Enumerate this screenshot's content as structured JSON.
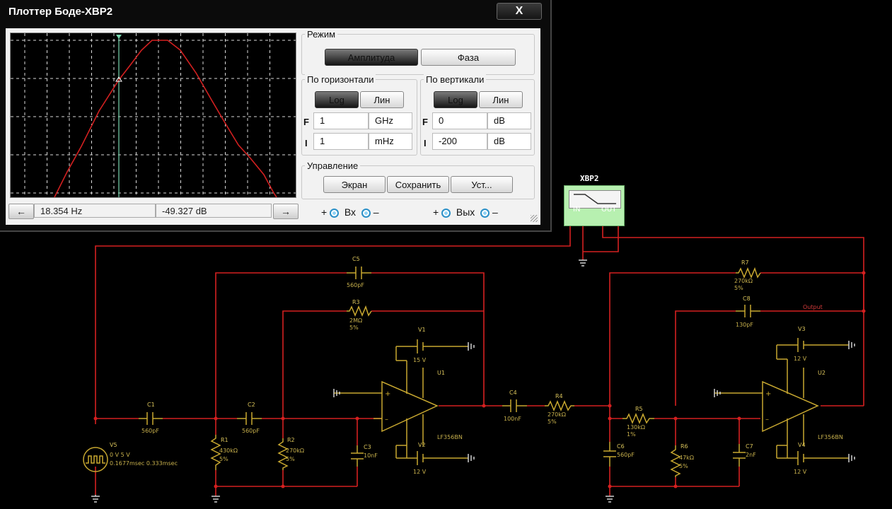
{
  "window": {
    "title": "Плоттер Боде-XBP2",
    "close_label": "X"
  },
  "plot": {
    "cursor_frequency": "18.354 Hz",
    "cursor_value": "-49.327 dB",
    "left_arrow": "←",
    "right_arrow": "→",
    "trace_color": "#d22020",
    "cursor_color": "#78d8b0"
  },
  "mode": {
    "title": "Режим",
    "amplitude_label": "Амплитуда",
    "phase_label": "Фаза",
    "active": "Амплитуда"
  },
  "horizontal": {
    "title": "По горизонтали",
    "log_label": "Log",
    "lin_label": "Лин",
    "active": "Log",
    "F_letter": "F",
    "I_letter": "I",
    "final_value": "1",
    "final_unit": "GHz",
    "initial_value": "1",
    "initial_unit": "mHz"
  },
  "vertical": {
    "title": "По вертикали",
    "log_label": "Log",
    "lin_label": "Лин",
    "active": "Log",
    "F_letter": "F",
    "I_letter": "I",
    "final_value": "0",
    "final_unit": "dB",
    "initial_value": "-200",
    "initial_unit": "dB"
  },
  "control": {
    "title": "Управление",
    "screen_label": "Экран",
    "save_label": "Сохранить",
    "settings_label": "Уст..."
  },
  "io": {
    "plus": "+",
    "minus": "–",
    "in_label": "Вх",
    "out_label": "Вых"
  },
  "instrument": {
    "name": "XBP2",
    "in_label": "IN",
    "out_label": "OUT"
  },
  "schematic": {
    "components": {
      "C5": {
        "label": "C5",
        "value": "560pF"
      },
      "R3": {
        "label": "R3",
        "value": "2MΩ",
        "tol": "5%"
      },
      "V1": {
        "label": "V1",
        "value": "15 V"
      },
      "U1": {
        "label": "U1",
        "part": "LF356BN"
      },
      "V2": {
        "label": "V2",
        "value": "12 V"
      },
      "C1": {
        "label": "C1",
        "value": "560pF"
      },
      "C2": {
        "label": "C2",
        "value": "560pF"
      },
      "R1": {
        "label": "R1",
        "value": "430kΩ",
        "tol": "5%"
      },
      "R2": {
        "label": "R2",
        "value": "270kΩ",
        "tol": "5%"
      },
      "C3": {
        "label": "C3",
        "value": "10nF"
      },
      "V5": {
        "label": "V5",
        "value": "0 V 5 V",
        "timing": "0.1677msec 0.333msec"
      },
      "C4": {
        "label": "C4",
        "value": "100nF"
      },
      "R4": {
        "label": "R4",
        "value": "270kΩ",
        "tol": "5%"
      },
      "R7": {
        "label": "R7",
        "value": "270kΩ",
        "tol": "5%"
      },
      "C8": {
        "label": "C8",
        "value": "130pF"
      },
      "output": "Output",
      "V3": {
        "label": "V3",
        "value": "12 V"
      },
      "U2": {
        "label": "U2",
        "part": "LF356BN"
      },
      "R5": {
        "label": "R5",
        "value": "130kΩ",
        "tol": "1%"
      },
      "C6": {
        "label": "C6",
        "value": "560pF"
      },
      "R6": {
        "label": "R6",
        "value": "47kΩ",
        "tol": "5%"
      },
      "C7": {
        "label": "C7",
        "value": "2nF"
      },
      "V4": {
        "label": "V4",
        "value": "12 V"
      }
    },
    "wire_color": "#d42020",
    "component_color": "#c8a830"
  }
}
